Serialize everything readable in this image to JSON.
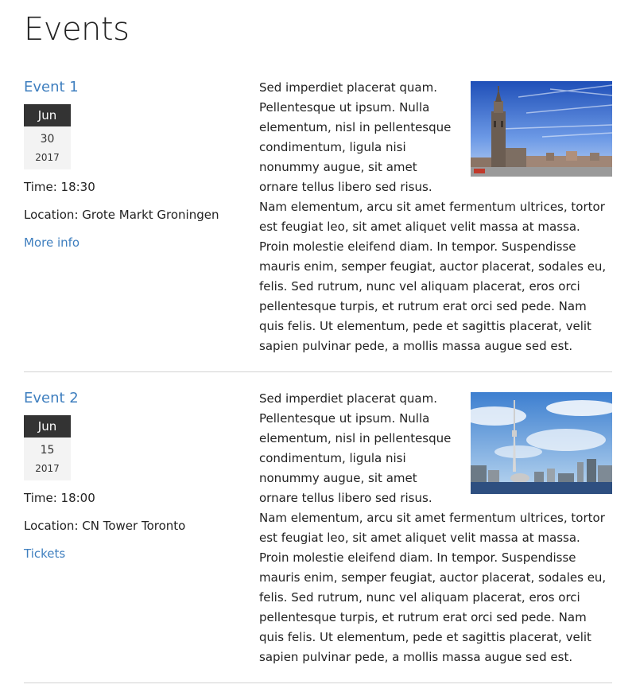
{
  "page": {
    "title": "Events"
  },
  "events": [
    {
      "title": "Event 1",
      "date": {
        "month": "Jun",
        "day": "30",
        "year": "2017"
      },
      "time": "Time: 18:30",
      "location": "Location: Grote Markt Groningen",
      "link_label": "More info",
      "image_icon": "church-tower-photo",
      "description": "Sed imperdiet placerat quam. Pellentesque ut ipsum. Nulla elementum, nisl in pellentesque condimentum, ligula nisi nonummy augue, sit amet ornare tellus libero sed risus. Nam elementum, arcu sit amet fermentum ultrices, tortor est feugiat leo, sit amet aliquet velit massa at massa. Proin molestie eleifend diam. In tempor. Suspendisse mauris enim, semper feugiat, auctor placerat, sodales eu, felis. Sed rutrum, nunc vel aliquam placerat, eros orci pellentesque turpis, et rutrum erat orci sed pede. Nam quis felis. Ut elementum, pede et sagittis placerat, velit sapien pulvinar pede, a mollis massa augue sed est."
    },
    {
      "title": "Event 2",
      "date": {
        "month": "Jun",
        "day": "15",
        "year": "2017"
      },
      "time": "Time: 18:00",
      "location": "Location: CN Tower Toronto",
      "link_label": "Tickets",
      "image_icon": "cn-tower-skyline-photo",
      "description": "Sed imperdiet placerat quam. Pellentesque ut ipsum. Nulla elementum, nisl in pellentesque condimentum, ligula nisi nonummy augue, sit amet ornare tellus libero sed risus. Nam elementum, arcu sit amet fermentum ultrices, tortor est feugiat leo, sit amet aliquet velit massa at massa. Proin molestie eleifend diam. In tempor. Suspendisse mauris enim, semper feugiat, auctor placerat, sodales eu, felis. Sed rutrum, nunc vel aliquam placerat, eros orci pellentesque turpis, et rutrum erat orci sed pede. Nam quis felis. Ut elementum, pede et sagittis placerat, velit sapien pulvinar pede, a mollis massa augue sed est."
    }
  ],
  "colors": {
    "link": "#3f7fbf",
    "month_bg": "#333333",
    "date_bg": "#f3f3f3",
    "divider": "#d2d2d2"
  }
}
